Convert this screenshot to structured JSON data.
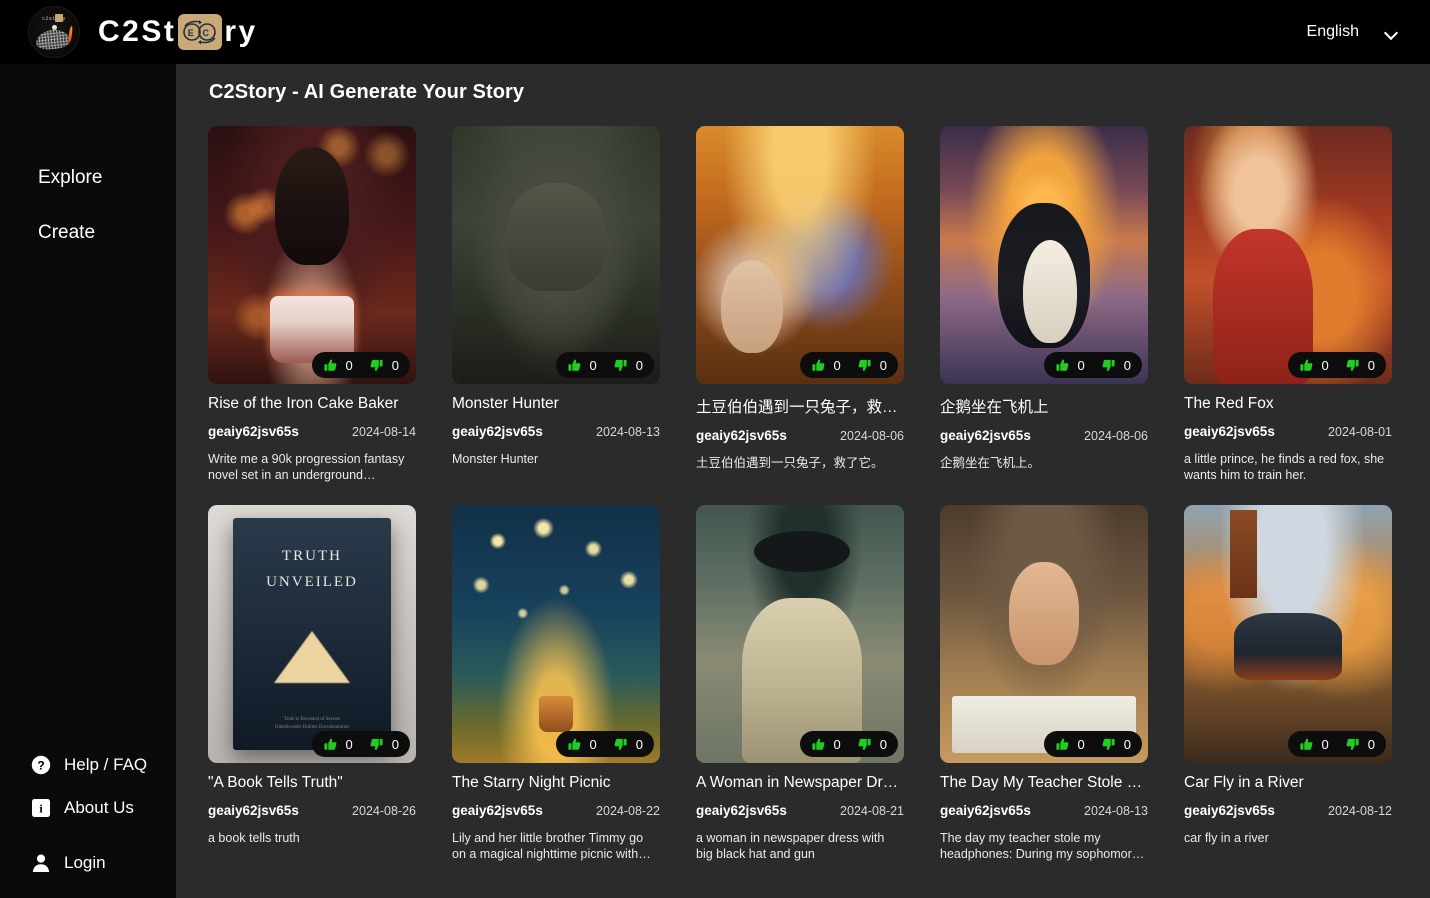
{
  "topbar": {
    "brand_pre": "C2St",
    "brand_post": "ry",
    "logo_icon": "c2story-circular-logo",
    "language_value": "English",
    "language_chevron": "chevron-down-icon"
  },
  "sidebar": {
    "primary": [
      {
        "label": "Explore",
        "name": "sidebar-item-explore"
      },
      {
        "label": "Create",
        "name": "sidebar-item-create"
      }
    ],
    "secondary": [
      {
        "label": "Help / FAQ",
        "icon": "question-mark-circle-icon",
        "name": "sidebar-item-help-faq"
      },
      {
        "label": "About Us",
        "icon": "info-square-icon",
        "name": "sidebar-item-about-us"
      },
      {
        "label": "Login",
        "icon": "user-person-icon",
        "name": "sidebar-item-login"
      }
    ]
  },
  "main": {
    "page_title": "C2Story - AI Generate Your Story",
    "vote_up_icon": "thumbs-up-icon",
    "vote_down_icon": "thumbs-down-icon",
    "accent_green": "#22cc22",
    "cards": [
      {
        "title": "Rise of the Iron Cake Baker",
        "author": "geaiy62jsv65s",
        "date": "2024-08-14",
        "description": "Write me a 90k progression fantasy novel set in an underground…",
        "likes": "0",
        "dislikes": "0",
        "art": "art-dwarf"
      },
      {
        "title": "Monster Hunter",
        "author": "geaiy62jsv65s",
        "date": "2024-08-13",
        "description": "Monster Hunter",
        "likes": "0",
        "dislikes": "0",
        "art": "art-monster"
      },
      {
        "title": "土豆伯伯遇到一只兔子，救…",
        "author": "geaiy62jsv65s",
        "date": "2024-08-06",
        "description": "土豆伯伯遇到一只兔子，救了它。",
        "likes": "0",
        "dislikes": "0",
        "art": "art-potato"
      },
      {
        "title": "企鹅坐在飞机上",
        "author": "geaiy62jsv65s",
        "date": "2024-08-06",
        "description": "企鹅坐在飞机上。",
        "likes": "0",
        "dislikes": "0",
        "art": "art-penguin"
      },
      {
        "title": "The Red Fox",
        "author": "geaiy62jsv65s",
        "date": "2024-08-01",
        "description": "a little prince, he finds a red fox, she wants him to train her.",
        "likes": "0",
        "dislikes": "0",
        "art": "art-fox"
      },
      {
        "title": "\"A Book Tells Truth\"",
        "author": "geaiy62jsv65s",
        "date": "2024-08-26",
        "description": "a book tells truth",
        "likes": "0",
        "dislikes": "0",
        "art": "art-book",
        "art_text": {
          "line1": "TRUTH",
          "line2": "UNVEILED"
        }
      },
      {
        "title": "The Starry Night Picnic",
        "author": "geaiy62jsv65s",
        "date": "2024-08-22",
        "description": "Lily and her little brother Timmy go on a magical nighttime picnic with…",
        "likes": "0",
        "dislikes": "0",
        "art": "art-stars"
      },
      {
        "title": "A Woman in Newspaper Dr…",
        "author": "geaiy62jsv65s",
        "date": "2024-08-21",
        "description": "a woman in newspaper dress with big black hat and gun",
        "likes": "0",
        "dislikes": "0",
        "art": "art-woman"
      },
      {
        "title": "The Day My Teacher Stole …",
        "author": "geaiy62jsv65s",
        "date": "2024-08-13",
        "description": "The day my teacher stole my headphones: During my sophomor…",
        "likes": "0",
        "dislikes": "0",
        "art": "art-teacher"
      },
      {
        "title": "Car Fly in a River",
        "author": "geaiy62jsv65s",
        "date": "2024-08-12",
        "description": "car fly in a river",
        "likes": "0",
        "dislikes": "0",
        "art": "art-car"
      }
    ]
  }
}
